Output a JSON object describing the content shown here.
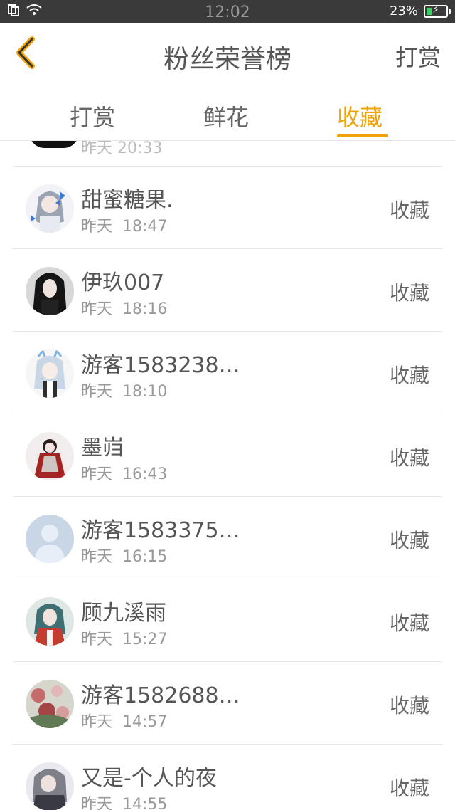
{
  "status_bar": {
    "time": "12:02",
    "battery_percent": "23%",
    "icons": [
      "copy-icon",
      "wifi-icon",
      "battery-charging-icon"
    ]
  },
  "nav": {
    "title": "粉丝荣誉榜",
    "back_icon": "chevron-left-icon",
    "right_action": "打赏",
    "accent": "#f0a30a"
  },
  "tabs": [
    {
      "label": "打赏",
      "active": false
    },
    {
      "label": "鲜花",
      "active": false
    },
    {
      "label": "收藏",
      "active": true
    }
  ],
  "list": {
    "partial_top_time": "昨天  20:33",
    "items": [
      {
        "name": "甜蜜糖果.",
        "date": "昨天",
        "time": "18:47",
        "action": "收藏",
        "avatar_style": "anime-blue-butterfly"
      },
      {
        "name": "伊玖007",
        "date": "昨天",
        "time": "18:16",
        "action": "收藏",
        "avatar_style": "dark-hair-girl"
      },
      {
        "name": "游客1583238…",
        "date": "昨天",
        "time": "18:10",
        "action": "收藏",
        "avatar_style": "anime-white-cat-ears"
      },
      {
        "name": "墨岿",
        "date": "昨天",
        "time": "16:43",
        "action": "收藏",
        "avatar_style": "anime-red-dress"
      },
      {
        "name": "游客1583375…",
        "date": "昨天",
        "time": "16:15",
        "action": "收藏",
        "avatar_style": "default-silhouette"
      },
      {
        "name": "顾九溪雨",
        "date": "昨天",
        "time": "15:27",
        "action": "收藏",
        "avatar_style": "anime-green-hair"
      },
      {
        "name": "游客1582688…",
        "date": "昨天",
        "time": "14:57",
        "action": "收藏",
        "avatar_style": "flowers"
      },
      {
        "name": "又是-个人的夜",
        "date": "昨天",
        "time": "14:55",
        "action": "收藏",
        "avatar_style": "anime-grey-hair"
      }
    ]
  }
}
